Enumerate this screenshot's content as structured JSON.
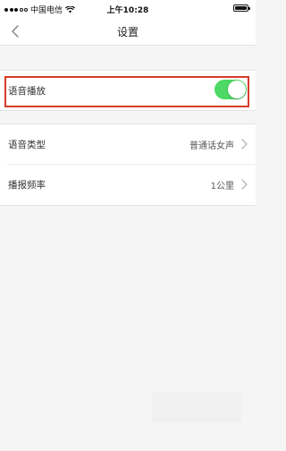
{
  "status_bar": {
    "carrier": "中国电信",
    "time": "上午10:28",
    "wifi_icon": "wifi-icon",
    "battery_icon": "battery-icon"
  },
  "nav": {
    "title": "设置",
    "back_icon": "chevron-left-icon"
  },
  "settings": {
    "voice_playback": {
      "label": "语音播放",
      "enabled": true
    },
    "voice_type": {
      "label": "语音类型",
      "value": "普通话女声"
    },
    "broadcast_frequency": {
      "label": "播报频率",
      "value": "1公里"
    }
  },
  "colors": {
    "toggle_on": "#4cd964",
    "highlight": "#d93a2b",
    "background": "#f5f5f5"
  }
}
